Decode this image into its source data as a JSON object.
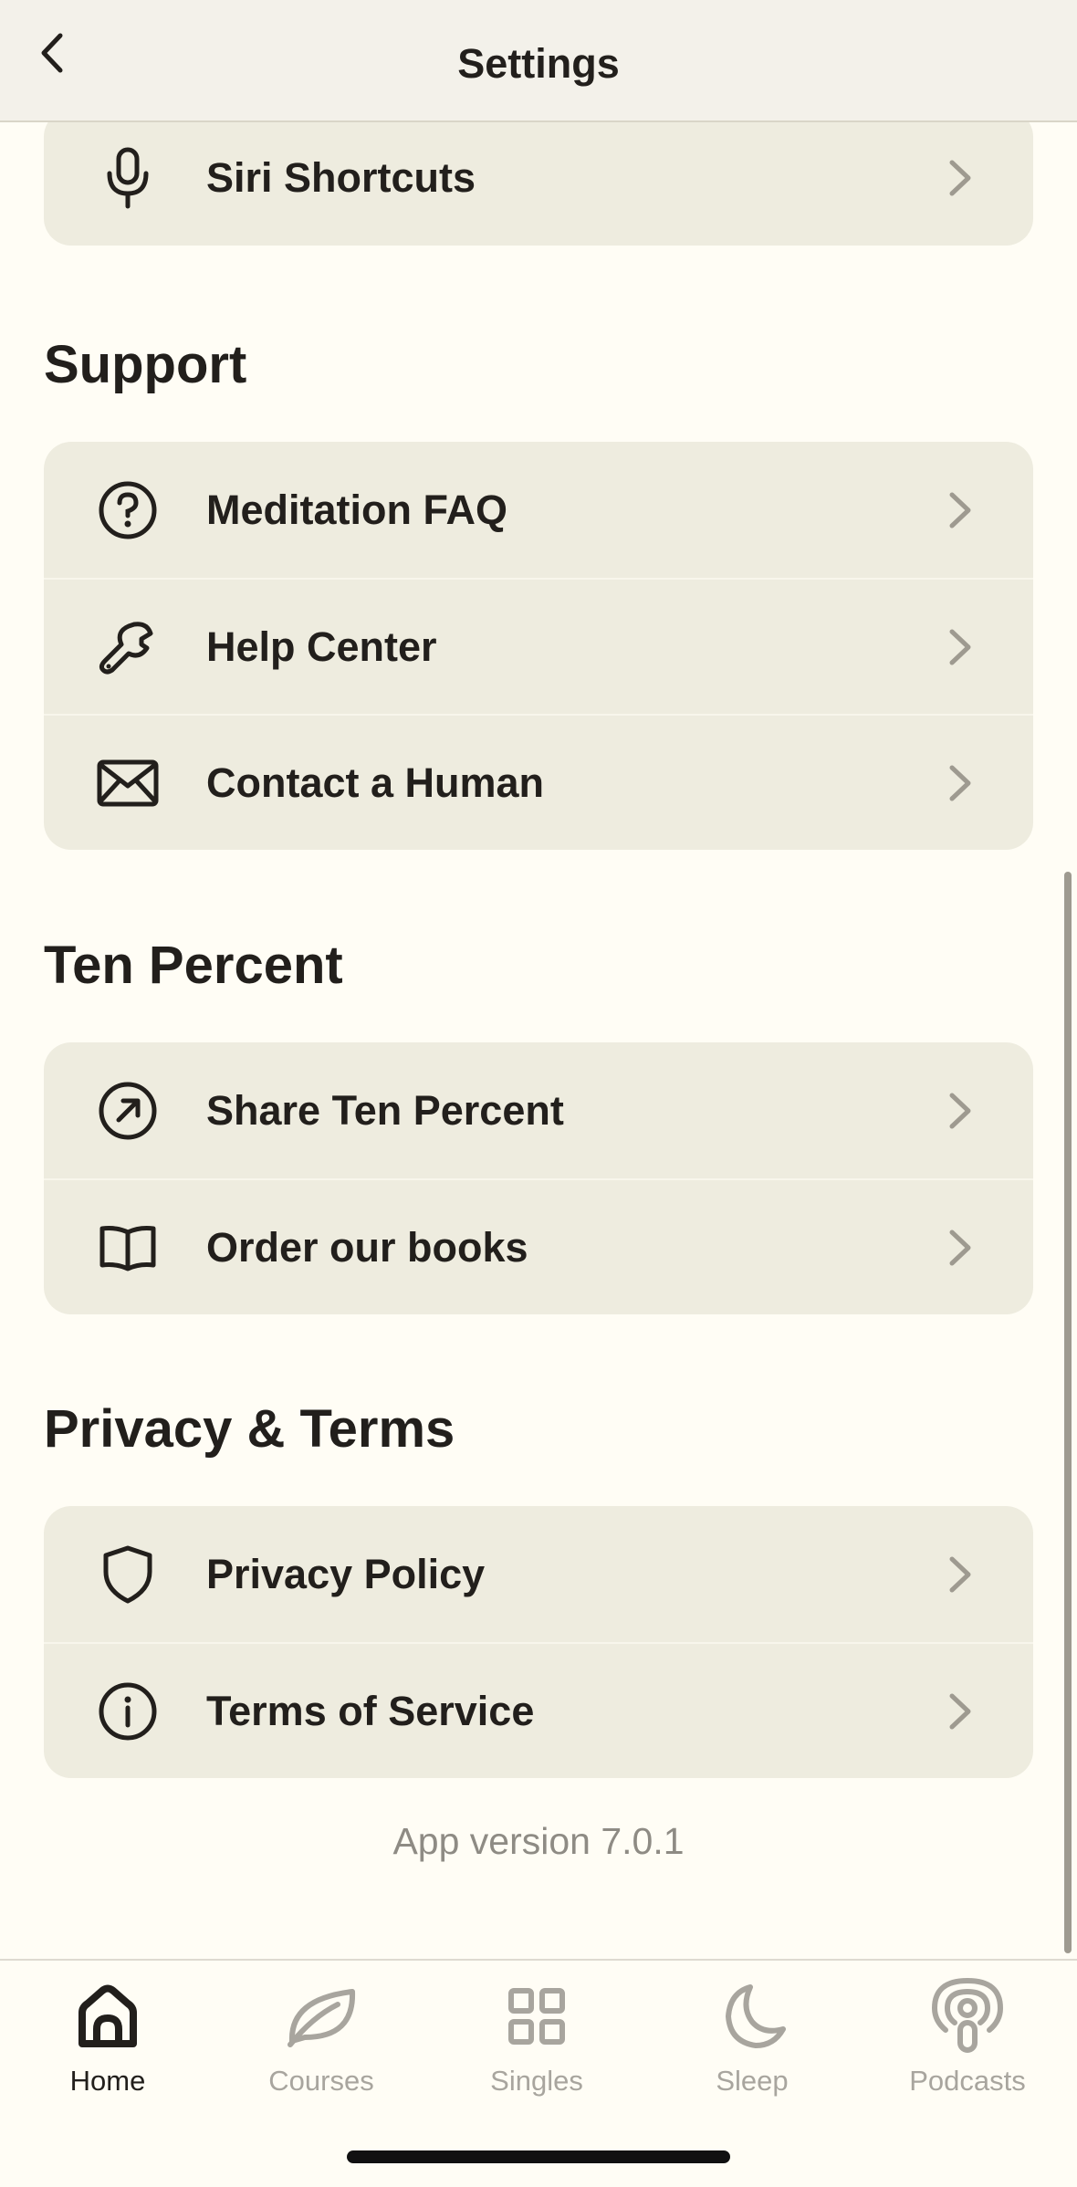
{
  "header": {
    "title": "Settings"
  },
  "top_card": {
    "items": [
      {
        "label": "Siri Shortcuts",
        "icon": "microphone-icon"
      }
    ]
  },
  "sections": [
    {
      "title": "Support",
      "items": [
        {
          "label": "Meditation FAQ",
          "icon": "question-circle-icon"
        },
        {
          "label": "Help Center",
          "icon": "wrench-icon"
        },
        {
          "label": "Contact a Human",
          "icon": "envelope-icon"
        }
      ]
    },
    {
      "title": "Ten Percent",
      "items": [
        {
          "label": "Share Ten Percent",
          "icon": "share-arrow-circle-icon"
        },
        {
          "label": "Order our books",
          "icon": "open-book-icon"
        }
      ]
    },
    {
      "title": "Privacy & Terms",
      "items": [
        {
          "label": "Privacy Policy",
          "icon": "shield-icon"
        },
        {
          "label": "Terms of Service",
          "icon": "info-circle-icon"
        }
      ]
    }
  ],
  "footer": {
    "version": "App version 7.0.1"
  },
  "tabbar": {
    "tabs": [
      {
        "label": "Home",
        "icon": "home-icon",
        "active": true
      },
      {
        "label": "Courses",
        "icon": "leaf-icon",
        "active": false
      },
      {
        "label": "Singles",
        "icon": "grid-icon",
        "active": false
      },
      {
        "label": "Sleep",
        "icon": "moon-icon",
        "active": false
      },
      {
        "label": "Podcasts",
        "icon": "podcast-icon",
        "active": false
      }
    ]
  },
  "colors": {
    "background": "#FFFDF5",
    "card": "#EEECDF",
    "text": "#221F1C",
    "muted": "#A8A59E",
    "chevron": "#9E9A90"
  }
}
